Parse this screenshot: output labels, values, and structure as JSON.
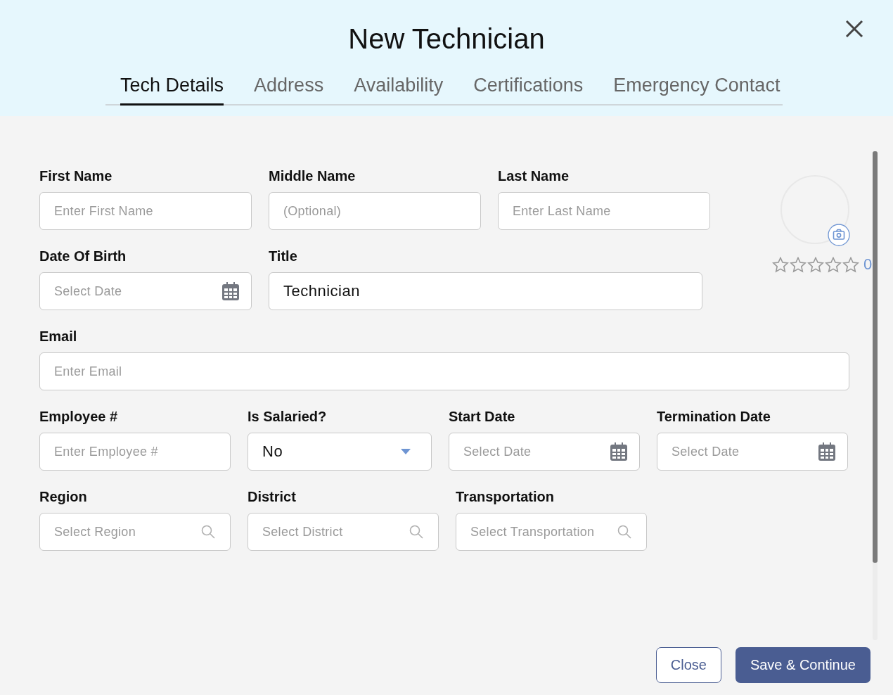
{
  "dialog": {
    "title": "New Technician"
  },
  "tabs": [
    {
      "label": "Tech Details",
      "selected": true
    },
    {
      "label": "Address",
      "selected": false
    },
    {
      "label": "Availability",
      "selected": false
    },
    {
      "label": "Certifications",
      "selected": false
    },
    {
      "label": "Emergency Contact",
      "selected": false
    }
  ],
  "form_rows": [
    [
      {
        "label": "First Name",
        "kind": "text",
        "placeholder": "Enter First Name"
      },
      {
        "label": "Middle Name",
        "kind": "text",
        "placeholder": "(Optional)"
      },
      {
        "label": "Last Name",
        "kind": "text",
        "placeholder": "Enter Last Name"
      }
    ],
    [
      {
        "label": "Date Of Birth",
        "kind": "date",
        "placeholder": "Select Date"
      },
      {
        "label": "Title",
        "kind": "text",
        "value": "Technician"
      }
    ],
    [
      {
        "label": "Email",
        "kind": "text",
        "placeholder": "Enter Email"
      }
    ],
    [
      {
        "label": "Employee #",
        "kind": "text",
        "placeholder": "Enter Employee #"
      },
      {
        "label": "Is Salaried?",
        "kind": "select",
        "value": "No"
      },
      {
        "label": "Start Date",
        "kind": "date",
        "placeholder": "Select Date"
      },
      {
        "label": "Termination Date",
        "kind": "date",
        "placeholder": "Select Date"
      }
    ],
    [
      {
        "label": "Region",
        "kind": "search",
        "placeholder": "Select Region"
      },
      {
        "label": "District",
        "kind": "search",
        "placeholder": "Select District"
      },
      {
        "label": "Transportation",
        "kind": "search",
        "placeholder": "Select Transportation"
      }
    ]
  ],
  "rating": {
    "stars": 0,
    "count": "0"
  },
  "buttons": [
    {
      "label": "Close",
      "kind": "secondary"
    },
    {
      "label": "Save & Continue",
      "kind": "primary"
    }
  ]
}
